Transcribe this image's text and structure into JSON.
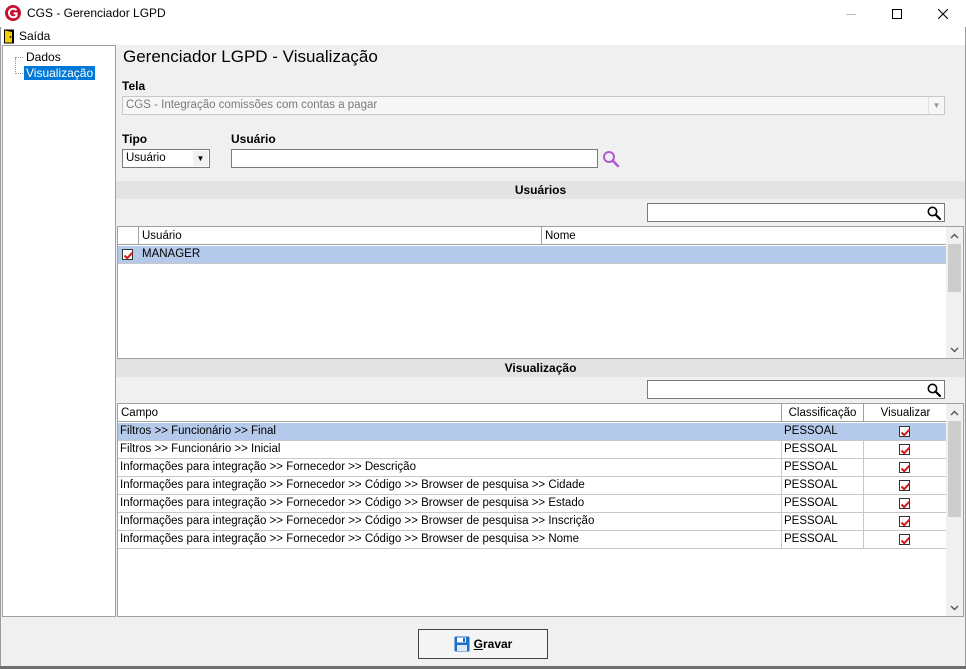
{
  "window": {
    "title": "CGS - Gerenciador LGPD"
  },
  "menu": {
    "saida": "Saída"
  },
  "tree": {
    "items": [
      "Dados",
      "Visualização"
    ]
  },
  "page": {
    "title": "Gerenciador LGPD - Visualização"
  },
  "tela": {
    "label": "Tela",
    "value": "CGS - Integração comissões com contas a pagar"
  },
  "tipo": {
    "label": "Tipo",
    "value": "Usuário"
  },
  "usuario": {
    "label": "Usuário",
    "value": ""
  },
  "usuarios_section": {
    "title": "Usuários",
    "filter_value": "",
    "columns": [
      "Usuário",
      "Nome"
    ],
    "rows": [
      {
        "checked": true,
        "usuario": "MANAGER",
        "nome": ""
      }
    ]
  },
  "visualizacao_section": {
    "title": "Visualização",
    "filter_value": "",
    "columns": [
      "Campo",
      "Classificação",
      "Visualizar"
    ],
    "rows": [
      {
        "campo": "Filtros >> Funcionário >> Final",
        "classificacao": "PESSOAL",
        "visualizar": true
      },
      {
        "campo": "Filtros >> Funcionário >> Inicial",
        "classificacao": "PESSOAL",
        "visualizar": true
      },
      {
        "campo": "Informações para integração >> Fornecedor >> Descrição",
        "classificacao": "PESSOAL",
        "visualizar": true
      },
      {
        "campo": "Informações para integração >> Fornecedor >> Código >> Browser de pesquisa >> Cidade",
        "classificacao": "PESSOAL",
        "visualizar": true
      },
      {
        "campo": "Informações para integração >> Fornecedor >> Código >> Browser de pesquisa >> Estado",
        "classificacao": "PESSOAL",
        "visualizar": true
      },
      {
        "campo": "Informações para integração >> Fornecedor >> Código >> Browser de pesquisa >> Inscrição",
        "classificacao": "PESSOAL",
        "visualizar": true
      },
      {
        "campo": "Informações para integração >> Fornecedor >> Código >> Browser de pesquisa >> Nome",
        "classificacao": "PESSOAL",
        "visualizar": true
      }
    ]
  },
  "buttons": {
    "gravar_first": "G",
    "gravar_rest": "ravar"
  },
  "colors": {
    "selection": "#0078d7",
    "row_selected": "#b5c9ea",
    "check": "#d01818",
    "search_icon": "#b05ad0"
  }
}
